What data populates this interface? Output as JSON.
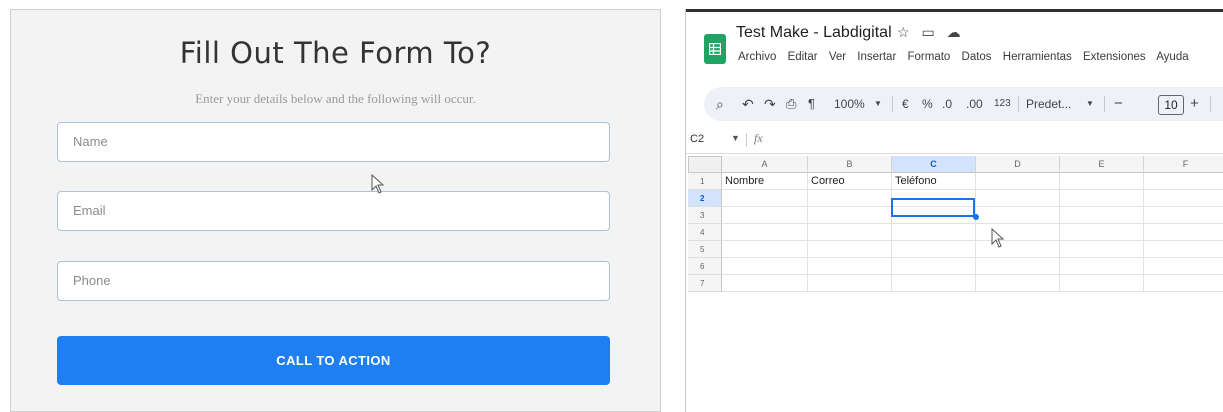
{
  "form": {
    "title": "Fill Out The Form To?",
    "subtitle": "Enter your details below and the following will occur.",
    "fields": [
      {
        "placeholder": "Name"
      },
      {
        "placeholder": "Email"
      },
      {
        "placeholder": "Phone"
      }
    ],
    "cta_label": "CALL TO ACTION",
    "accent_color": "#1f7ef0"
  },
  "sheet": {
    "doc_title": "Test Make - Labdigital",
    "title_icons": [
      "star-icon",
      "move-folder-icon",
      "cloud-status-icon"
    ],
    "menu": [
      "Archivo",
      "Editar",
      "Ver",
      "Insertar",
      "Formato",
      "Datos",
      "Herramientas",
      "Extensiones",
      "Ayuda"
    ],
    "toolbar": {
      "zoom": "100%",
      "currency": "€",
      "percent": "%",
      "decrease_decimals": ".0",
      "increase_decimals": ".00",
      "number_format": "123",
      "font": "Predet...",
      "font_size": "10",
      "minus": "−",
      "plus": "+"
    },
    "name_box": "C2",
    "fx": "fx",
    "columns": [
      "A",
      "B",
      "C",
      "D",
      "E",
      "F"
    ],
    "selected_column": "C",
    "rows": [
      "1",
      "2",
      "3",
      "4",
      "5",
      "6",
      "7"
    ],
    "selected_row": "2",
    "cells": {
      "A1": "Nombre",
      "B1": "Correo",
      "C1": "Teléfono"
    },
    "brand_color": "#1fa463",
    "selection_color": "#1a73e8"
  }
}
